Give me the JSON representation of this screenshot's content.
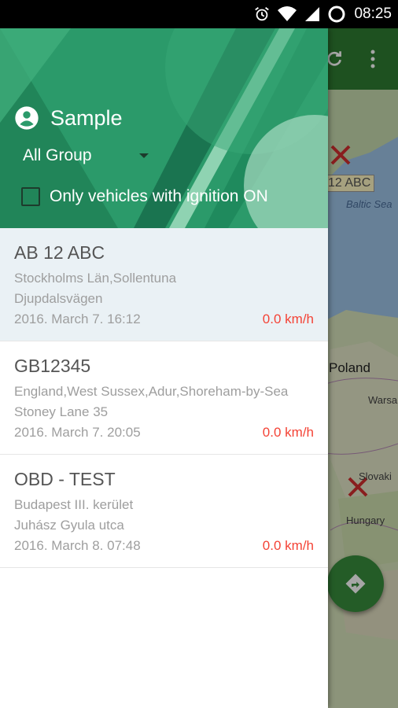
{
  "status_bar": {
    "time": "08:25",
    "icons": [
      "alarm-icon",
      "wifi-icon",
      "signal-icon",
      "sync-icon"
    ]
  },
  "map": {
    "labels": {
      "plate_marker": "12 ABC",
      "sea": "Baltic Sea",
      "poland": "Poland",
      "warsaw": "Warsa",
      "slovakia": "Slovaki",
      "hungary": "Hungary"
    },
    "fab_icon": "directions-icon"
  },
  "drawer": {
    "account_name": "Sample",
    "group_selected": "All Group",
    "ignition_filter_label": "Only vehicles with ignition ON",
    "ignition_filter_checked": false,
    "header_color": "#2b9a6a"
  },
  "vehicles": [
    {
      "plate": "AB 12 ABC",
      "address_line1": "Stockholms Län,Sollentuna",
      "address_line2": "Djupdalsvägen",
      "time": "2016. March 7. 16:12",
      "speed": "0.0 km/h",
      "selected": true
    },
    {
      "plate": "GB12345",
      "address_line1": "England,West Sussex,Adur,Shoreham-by-Sea",
      "address_line2": "Stoney Lane 35",
      "time": "2016. March 7. 20:05",
      "speed": "0.0 km/h",
      "selected": false
    },
    {
      "plate": "OBD - TEST",
      "address_line1": "Budapest III. kerület",
      "address_line2": "Juhász Gyula utca",
      "time": "2016. March 8. 07:48",
      "speed": "0.0 km/h",
      "selected": false
    }
  ]
}
